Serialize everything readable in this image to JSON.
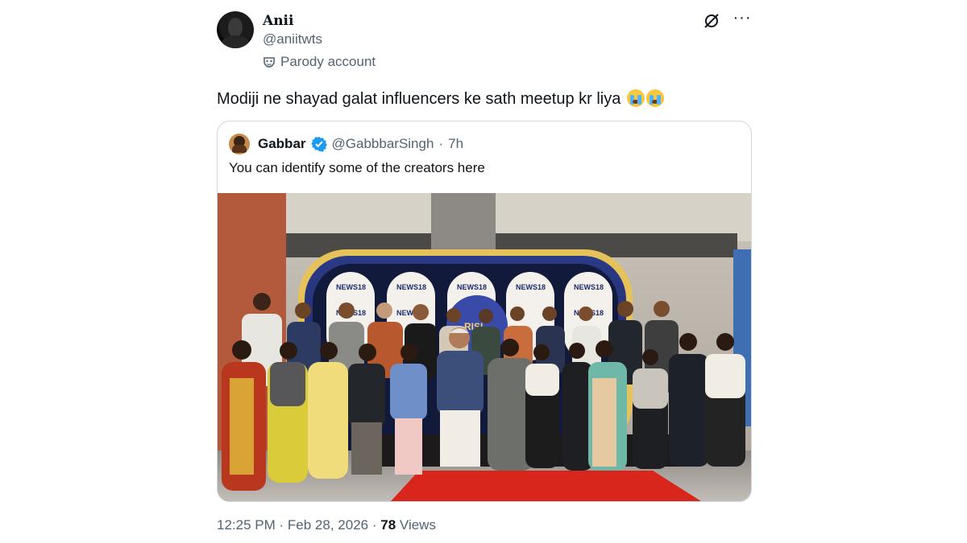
{
  "tweet": {
    "author_name": "Anii",
    "author_handle": "@aniitwts",
    "account_label": "Parody account",
    "text": "Modiji ne shayad galat influencers ke sath meetup kr liya",
    "emoji": [
      "loudly-crying-face",
      "loudly-crying-face"
    ]
  },
  "quote": {
    "author_name": "Gabbar",
    "author_handle": "@GabbbarSingh",
    "separator": "·",
    "time_ago": "7h",
    "text": "You can identify some of the creators here",
    "photo": {
      "backdrop_logos": [
        "NEWS18",
        "NEWS18",
        "NEWS18",
        "NEWS18",
        "NEWS18",
        "NEWS18",
        "NEWS18",
        "NEWS18"
      ],
      "centre_sign": "RISI"
    }
  },
  "meta": {
    "time": "12:25 PM",
    "sep1": "·",
    "date": "Feb 28, 2026",
    "sep2": "·",
    "views_count": "78",
    "views_label": "Views"
  },
  "colors": {
    "text_primary": "#0f1419",
    "text_secondary": "#536471",
    "border": "#cfd9de",
    "verified_blue": "#1d9bf0",
    "carpet_red": "#d8261c"
  },
  "icons": {
    "account_label": "mask-icon",
    "grok": "grok-icon",
    "more": "more-icon",
    "verified": "verified-badge-icon"
  }
}
